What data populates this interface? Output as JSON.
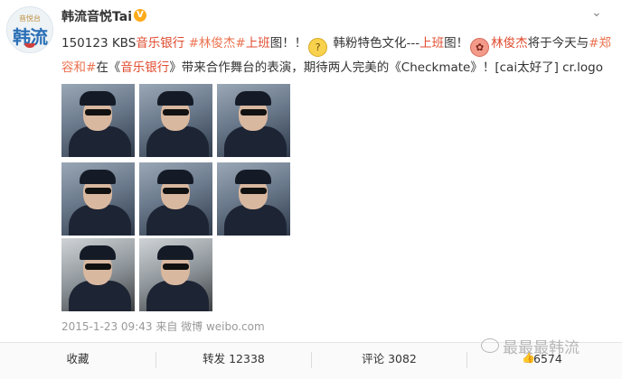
{
  "post": {
    "username": "韩流音悦Tai",
    "verified_mark": "V",
    "avatar": {
      "top": "音悦台",
      "main": "韩流"
    },
    "text": {
      "p1": "150123 KBS",
      "p2": "音乐银行",
      "p3": " ",
      "p4": "#林俊杰#",
      "p5": "上班",
      "p6": "图！！",
      "p7": " 韩粉特色文化---",
      "p8": "上班",
      "p9": "图！",
      "p10": "林俊杰",
      "p11": "将于今天与",
      "p12": "#郑容和#",
      "p13": "在《",
      "p14": "音乐银行",
      "p15": "》带来合作舞台的表演，期待两人完美的《Checkmate》！[cai太好了] cr.logo"
    },
    "images_count": 8,
    "meta": "2015-1-23 09:43 来自 微博 weibo.com"
  },
  "actions": {
    "favorite": "收藏",
    "repost": "转发 12338",
    "comment": "评论 3082",
    "like": "6574"
  },
  "watermark": "最最最韩流",
  "colors": {
    "hashtag": "#eb7350",
    "link": "#e04b2f",
    "badge": "#ffab1a"
  }
}
